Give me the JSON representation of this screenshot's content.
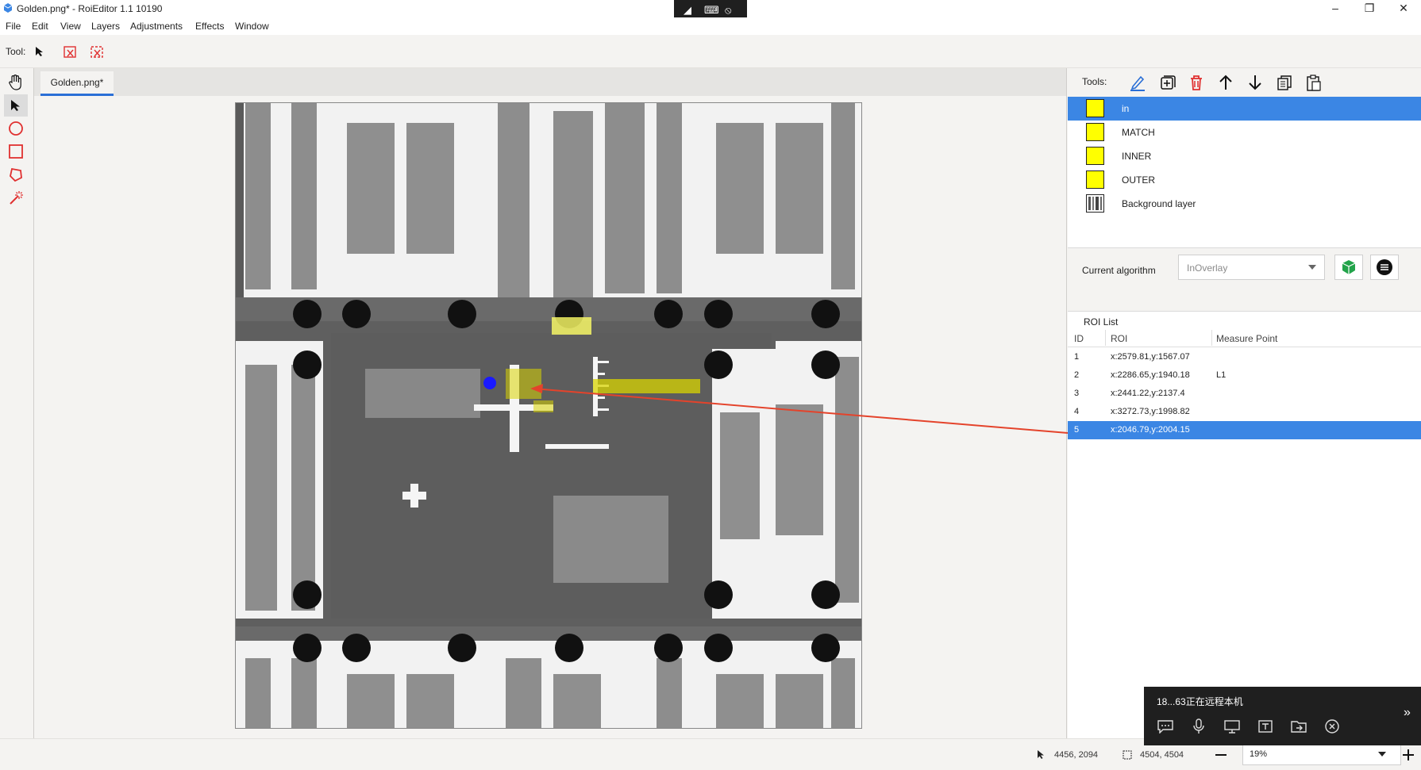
{
  "window": {
    "title": "Golden.png* - RoiEditor 1.1 10190",
    "remote_icons": [
      "screen-cast-icon",
      "keyboard-icon",
      "close-circle-icon"
    ]
  },
  "menu": [
    "File",
    "Edit",
    "View",
    "Layers",
    "Adjustments",
    "Effects",
    "Window"
  ],
  "toolbar": {
    "tool_label": "Tool:",
    "icons": [
      "arrow-select-icon",
      "delete-roi-icon",
      "delete-roi-alt-icon"
    ]
  },
  "left_tools": [
    "hand-icon",
    "pointer-icon",
    "circle-icon",
    "rectangle-icon",
    "polygon-icon",
    "magic-wand-icon"
  ],
  "document": {
    "tab_label": "Golden.png*"
  },
  "right_panel": {
    "tools_label": "Tools:",
    "tool_icons": [
      "edit-icon",
      "add-layer-icon",
      "delete-icon",
      "move-up-icon",
      "move-down-icon",
      "copy-icon",
      "paste-icon"
    ],
    "layers": [
      {
        "name": "in",
        "selected": true
      },
      {
        "name": "MATCH",
        "selected": false
      },
      {
        "name": "INNER",
        "selected": false
      },
      {
        "name": "OUTER",
        "selected": false
      },
      {
        "name": "Background layer",
        "selected": false
      }
    ],
    "algorithm": {
      "label": "Current algorithm",
      "value": "InOverlay"
    },
    "roi_list": {
      "title": "ROI List",
      "columns": [
        "ID",
        "ROI",
        "Measure Point"
      ],
      "rows": [
        {
          "id": "1",
          "roi": "x:2579.81,y:1567.07",
          "measure": ""
        },
        {
          "id": "2",
          "roi": "x:2286.65,y:1940.18",
          "measure": "L1"
        },
        {
          "id": "3",
          "roi": "x:2441.22,y:2137.4",
          "measure": ""
        },
        {
          "id": "4",
          "roi": "x:3272.73,y:1998.82",
          "measure": ""
        },
        {
          "id": "5",
          "roi": "x:2046.79,y:2004.15",
          "measure": ""
        }
      ],
      "selected_row": 4
    }
  },
  "status": {
    "cursor": "4456, 2094",
    "size": "4504, 4504",
    "zoom": "19%"
  },
  "remote_panel": {
    "user_text": "18...63正在远程本机",
    "icons": [
      "chat-icon",
      "mic-icon",
      "screen-share-icon",
      "text-icon",
      "file-transfer-icon",
      "disconnect-icon"
    ]
  },
  "colors": {
    "accent": "#3b86e4",
    "roi_yellow": "#ffff00",
    "annotation_red": "#e4432b",
    "marker_blue": "#1a1aff"
  }
}
